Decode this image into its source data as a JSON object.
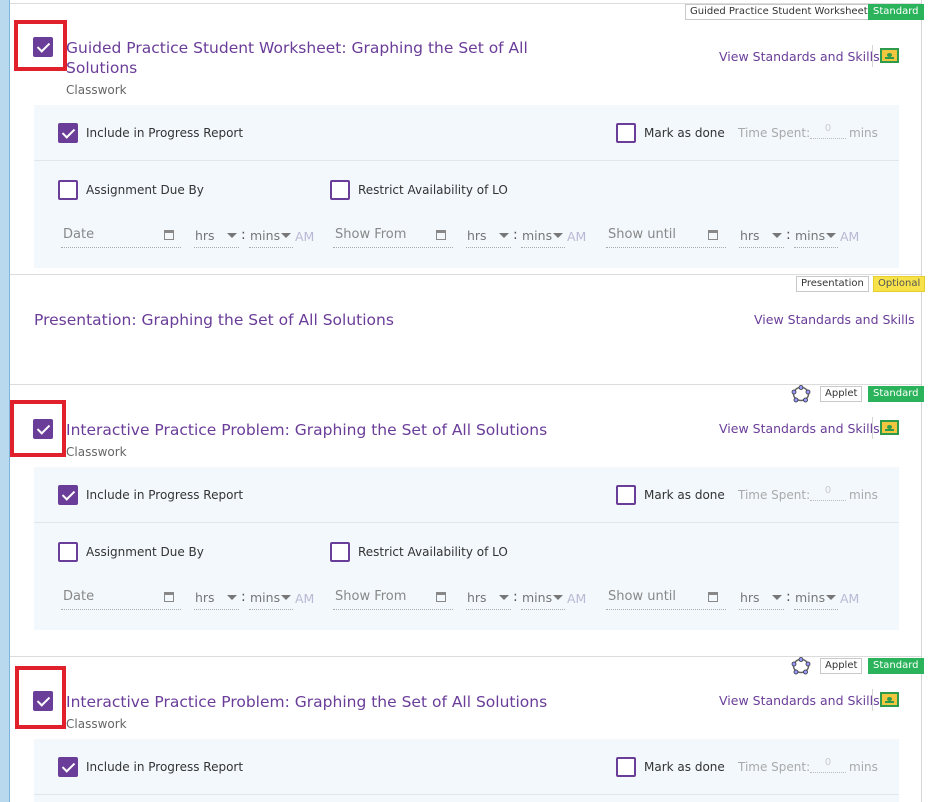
{
  "cards": [
    {
      "title": "Guided Practice Student Worksheet: Graphing the Set of All Solutions",
      "title_line1": "Guided Practice Student Worksheet: Graphing the Set of All",
      "title_line2": "Solutions",
      "subtitle": "Classwork",
      "type_tag": "Guided Practice Student Worksheet",
      "level_tag": "Standard",
      "standards_link": "View Standards and Skills",
      "selected": true
    },
    {
      "title": "Presentation: Graphing the Set of All Solutions",
      "type_tag": "Presentation",
      "level_tag": "Optional",
      "standards_link": "View Standards and Skills"
    },
    {
      "title": "Interactive Practice Problem: Graphing the Set of All Solutions",
      "subtitle": "Classwork",
      "type_tag": "Applet",
      "level_tag": "Standard",
      "standards_link": "View Standards and Skills",
      "selected": true
    },
    {
      "title": "Interactive Practice Problem: Graphing the Set of All Solutions",
      "subtitle": "Classwork",
      "type_tag": "Applet",
      "level_tag": "Standard",
      "standards_link": "View Standards and Skills",
      "selected": true
    }
  ],
  "options": {
    "include_progress": "Include in Progress Report",
    "mark_done": "Mark as done",
    "time_spent": "Time Spent:",
    "time_value": "0",
    "mins": "mins",
    "assignment_due": "Assignment Due By",
    "restrict": "Restrict Availability of LO",
    "date": "Date",
    "show_from": "Show From",
    "show_until": "Show until",
    "hrs": "hrs",
    "mins_select": "mins",
    "colon": ":",
    "ampm": "AM"
  },
  "icons": {
    "classroom": "google-classroom-icon",
    "geogebra": "geogebra-icon",
    "calendar": "calendar-icon",
    "caret": "caret-down-icon",
    "check": "checkmark-icon"
  },
  "colors": {
    "accent": "#6a3d99",
    "standard": "#2bb35b",
    "optional": "#f7e24a",
    "highlight": "#e0202a",
    "panel": "#f2f8fc"
  }
}
